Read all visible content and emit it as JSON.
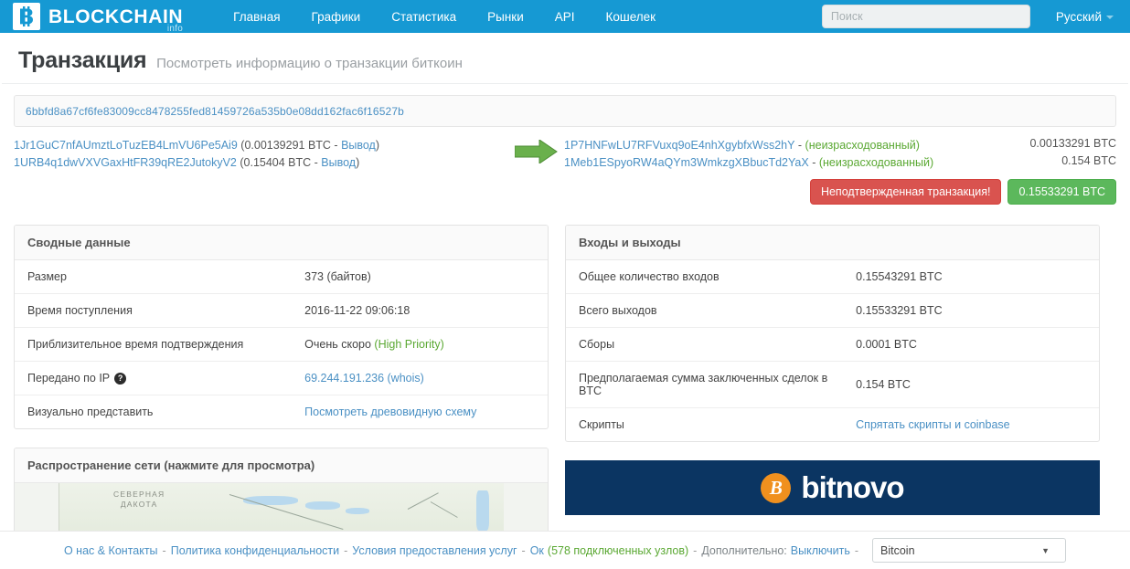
{
  "header": {
    "brand": {
      "name": "BLOCKCHAIN",
      "sub": "info",
      "logo_icon": "bitcoin-logo-icon"
    },
    "nav": [
      {
        "label": "Главная",
        "name": "nav-home"
      },
      {
        "label": "Графики",
        "name": "nav-charts"
      },
      {
        "label": "Статистика",
        "name": "nav-stats"
      },
      {
        "label": "Рынки",
        "name": "nav-markets"
      },
      {
        "label": "API",
        "name": "nav-api"
      },
      {
        "label": "Кошелек",
        "name": "nav-wallet"
      }
    ],
    "search": {
      "placeholder": "Поиск",
      "value": ""
    },
    "language": "Русский"
  },
  "page": {
    "title": "Транзакция",
    "subtitle": "Посмотреть информацию о транзакции биткоин",
    "hash": "6bbfd8a67cf6fe83009cc8478255fed81459726a535b0e08dd162fac6f16527b"
  },
  "io": {
    "inputs": [
      {
        "address": "1Jr1GuC7nfAUmztLoTuzEB4LmVU6Pe5Ai9",
        "amount": "0.00139291 BTC",
        "action": "Вывод"
      },
      {
        "address": "1URB4q1dwVXVGaxHtFR39qRE2JutokyV2",
        "amount": "0.15404 BTC",
        "action": "Вывод"
      }
    ],
    "outputs": [
      {
        "address": "1P7HNFwLU7RFVuxq9oE4nhXgybfxWss2hY",
        "status": "(неизрасходованный)",
        "amount": "0.00133291 BTC"
      },
      {
        "address": "1Meb1ESpyoRW4aQYm3WmkzgXBbucTd2YaX",
        "status": "(неизрасходованный)",
        "amount": "0.154 BTC"
      }
    ],
    "unconfirmed_label": "Неподтвержденная транзакция!",
    "total_label": "0.15533291 BTC",
    "arrow_icon": "green-arrow-right-icon"
  },
  "summary_panel": {
    "title": "Сводные данные",
    "rows": [
      {
        "key": "Размер",
        "value": "373 (байтов)",
        "type": "text"
      },
      {
        "key": "Время поступления",
        "value": "2016-11-22 09:06:18",
        "type": "text"
      },
      {
        "key": "Приблизительное время подтверждения",
        "value": "Очень скоро ",
        "extra": "(High Priority)",
        "type": "priority"
      },
      {
        "key": "Передано по IP",
        "value": "69.244.191.236 (whois)",
        "type": "link",
        "help_icon": "?"
      },
      {
        "key": "Визуально представить",
        "value": "Посмотреть древовидную схему",
        "type": "link"
      }
    ]
  },
  "io_panel": {
    "title": "Входы и выходы",
    "rows": [
      {
        "key": "Общее количество входов",
        "value": "0.15543291 BTC",
        "type": "text"
      },
      {
        "key": "Всего выходов",
        "value": "0.15533291 BTC",
        "type": "text"
      },
      {
        "key": "Сборы",
        "value": "0.0001 BTC",
        "type": "text"
      },
      {
        "key": "Предполагаемая сумма заключенных сделок в BTC",
        "value": "0.154 BTC",
        "type": "text"
      },
      {
        "key": "Скрипты",
        "value": "Спрятать скрипты и coinbase",
        "type": "link"
      }
    ]
  },
  "map_panel": {
    "title": "Распространение сети (нажмите для просмотра)",
    "region_label_line1": "СЕВЕРНАЯ",
    "region_label_line2": "ДАКОТА"
  },
  "ad": {
    "brand": "bitnovo",
    "coin_glyph": "B"
  },
  "footer": {
    "about": "О нас & Контакты",
    "privacy": "Политика конфиденциальности",
    "terms": "Условия предоставления услуг",
    "ok_label": "Ок",
    "nodes": "(578 подключенных узлов)",
    "more_label": "Дополнительно:",
    "disable": "Выключить",
    "currency_selected": "Bitcoin"
  },
  "colors": {
    "navbar": "#1699d3",
    "link": "#4a90c4",
    "danger": "#d9534f",
    "success": "#5cb85c",
    "green_text": "#5aa832",
    "ad_bg": "#0b3562",
    "ad_coin": "#f0901e"
  }
}
